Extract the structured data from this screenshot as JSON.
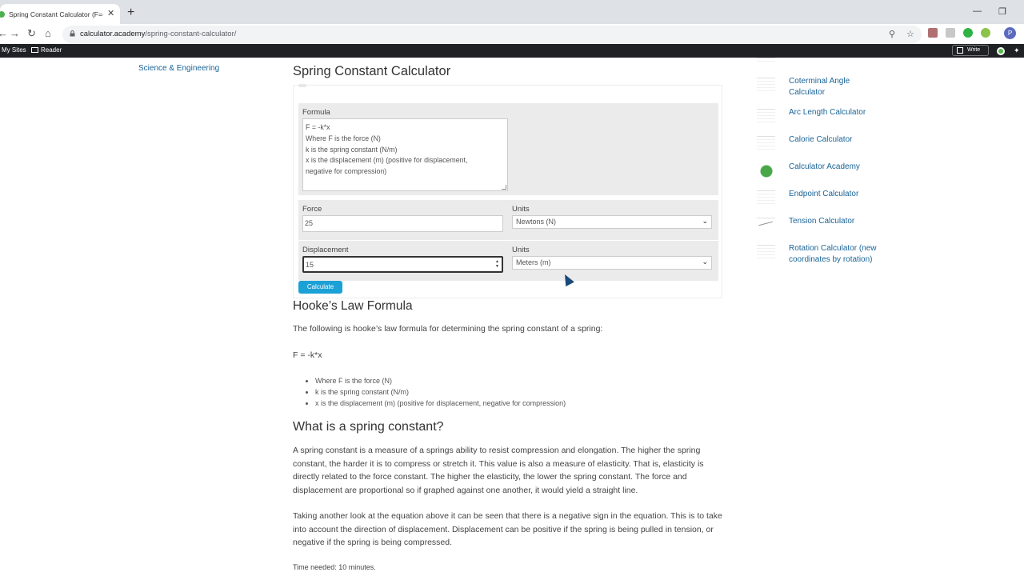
{
  "browser": {
    "tab_title": "Spring Constant Calculator (F=-k",
    "url_host": "calculator.academy",
    "url_path": "/spring-constant-calculator/"
  },
  "bookmarks": {
    "my_sites": "My Sites",
    "reader": "Reader",
    "write": "Write"
  },
  "left_nav": {
    "category": "Science & Engineering"
  },
  "page": {
    "title": "Spring Constant Calculator"
  },
  "calculator": {
    "formula_label": "Formula",
    "formula_lines": [
      "F = -k*x",
      "Where F is the force (N)",
      "k is the spring constant (N/m)",
      "x is the displacement (m) (positive for displacement,",
      "negative for compression)"
    ],
    "force_label": "Force",
    "force_value": "25",
    "force_units_label": "Units",
    "force_units": "Newtons (N)",
    "displacement_label": "Displacement",
    "displacement_value": "15",
    "displacement_units_label": "Units",
    "displacement_units": "Meters (m)",
    "calculate_label": "Calculate"
  },
  "article": {
    "hooke_heading": "Hooke’s Law Formula",
    "hooke_intro": "The following is hooke’s law formula for determining the spring constant of a spring:",
    "formula": "F = -k*x",
    "bullets": [
      "Where F is the force (N)",
      "k is the spring constant (N/m)",
      "x is the displacement (m) (positive for displacement, negative for compression)"
    ],
    "what_heading": "What is a spring constant?",
    "para1": "A spring constant is a measure of a springs ability to resist compression and elongation. The higher the spring constant, the harder it is to compress or stretch it. This value is also a measure of elasticity. That is, elasticity is directly related to the force constant. The higher the elasticity, the lower the spring constant. The force and displacement are proportional so if graphed against one another, it would yield a straight line.",
    "para2": "Taking another look at the equation above it can be seen that there is a negative sign in the equation. This is to take into account the direction of displacement. Displacement can be positive if the spring is being pulled in tension, or negative if the spring is being compressed.",
    "time_needed": "Time needed: 10 minutes."
  },
  "sidebar": {
    "items": [
      {
        "label": "Coterminal Angle Calculator"
      },
      {
        "label": "Arc Length Calculator"
      },
      {
        "label": "Calorie Calculator"
      },
      {
        "label": "Calculator Academy"
      },
      {
        "label": "Endpoint Calculator"
      },
      {
        "label": "Tension Calculator"
      },
      {
        "label": "Rotation Calculator (new coordinates by rotation)"
      }
    ]
  },
  "colors": {
    "link": "#1a6496",
    "button": "#1ba1d6",
    "panel": "#ebebeb"
  }
}
